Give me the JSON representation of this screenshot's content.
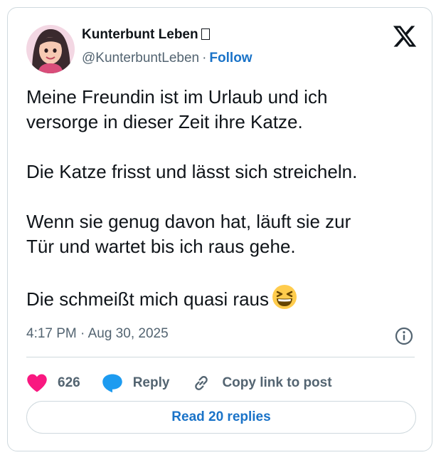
{
  "author": {
    "display_name": "Kunterbunt Leben",
    "handle": "@KunterbuntLeben",
    "separator": "·",
    "follow_label": "Follow"
  },
  "post": {
    "lines": [
      "Meine Freundin ist im Urlaub und ich",
      "versorge in dieser Zeit ihre Katze.",
      "Die Katze frisst und lässt sich streicheln.",
      "Wenn sie genug davon hat, läuft sie zur",
      "Tür und wartet bis ich raus gehe.",
      "Die schmeißt mich quasi raus"
    ],
    "timestamp": "4:17 PM · Aug 30, 2025"
  },
  "actions": {
    "like_count": "626",
    "reply_label": "Reply",
    "copy_link_label": "Copy link to post"
  },
  "footer": {
    "read_replies_label": "Read 20 replies"
  },
  "colors": {
    "like": "#f91880",
    "reply": "#1d9bf0",
    "link": "#1a73c8",
    "muted": "#536471",
    "border": "#cfd9de"
  },
  "icons": {
    "logo": "x-logo-icon",
    "emoji": "grinning-squinting-face-icon",
    "info": "info-icon",
    "like": "heart-icon",
    "reply": "speech-bubble-icon",
    "copy": "link-icon"
  }
}
